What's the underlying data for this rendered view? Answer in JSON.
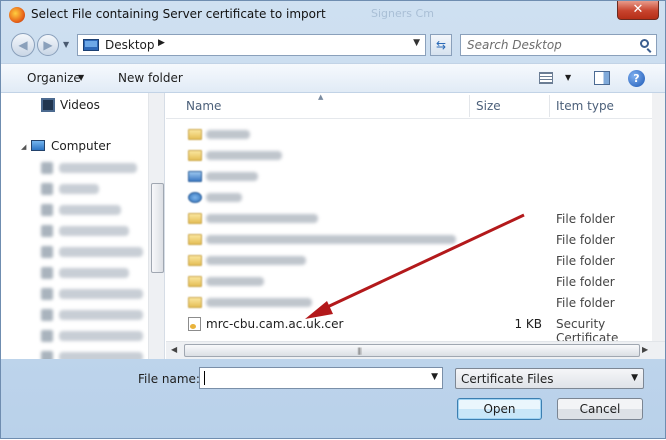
{
  "window": {
    "title": "Select File containing Server certificate to import",
    "ghost_title": "Signers Cm",
    "close_label": "✕"
  },
  "address": {
    "location": "Desktop",
    "search_placeholder": "Search Desktop"
  },
  "toolbar": {
    "organize_label": "Organize",
    "new_folder_label": "New folder"
  },
  "nav_pane": {
    "videos_label": "Videos",
    "computer_label": "Computer"
  },
  "file_list": {
    "columns": {
      "name": "Name",
      "size": "Size",
      "type": "Item type"
    },
    "rows": [
      {
        "name": "",
        "size": "",
        "type": ""
      },
      {
        "name": "",
        "size": "",
        "type": ""
      },
      {
        "name": "",
        "size": "",
        "type": ""
      },
      {
        "name": "",
        "size": "",
        "type": ""
      },
      {
        "name": "",
        "size": "",
        "type": "File folder"
      },
      {
        "name": "",
        "size": "",
        "type": "File folder"
      },
      {
        "name": "",
        "size": "",
        "type": "File folder"
      },
      {
        "name": "",
        "size": "",
        "type": "File folder"
      },
      {
        "name": "",
        "size": "",
        "type": "File folder"
      },
      {
        "name": "mrc-cbu.cam.ac.uk.cer",
        "size": "1 KB",
        "type": "Security Certificate"
      }
    ]
  },
  "bottom": {
    "file_name_label": "File name:",
    "file_name_value": "",
    "file_type_selected": "Certificate Files",
    "open_label": "Open",
    "cancel_label": "Cancel"
  },
  "colors": {
    "annotation_arrow": "#b3191b",
    "window_frame": "#b9d1ea"
  }
}
